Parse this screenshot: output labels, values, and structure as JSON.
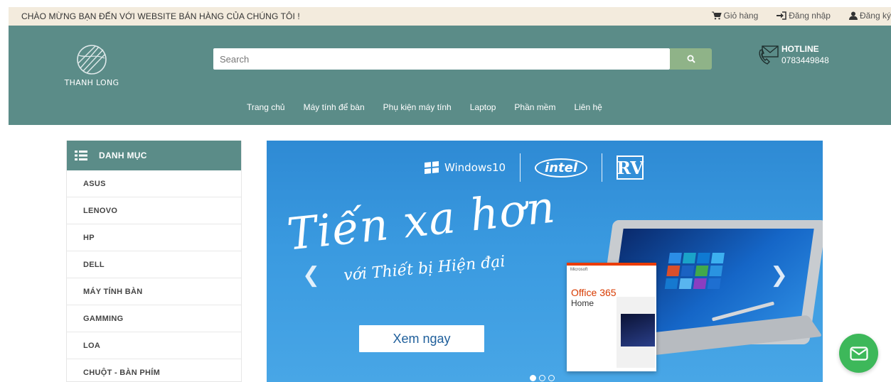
{
  "topbar": {
    "welcome": "CHÀO MỪNG BẠN ĐẾN VỚI WEBSITE BÁN HÀNG CỦA CHÚNG TÔI !",
    "cart": "Giỏ hàng",
    "login": "Đăng nhập",
    "register": "Đăng ký"
  },
  "header": {
    "logo_text": "THANH LONG",
    "search_placeholder": "Search",
    "hotline_title": "HOTLINE",
    "hotline_phone": "0783449848",
    "brand_color": "#5b8c88",
    "search_button_color": "#8fb388"
  },
  "nav": [
    "Trang chủ",
    "Máy tính để bàn",
    "Phụ kiện máy tính",
    "Laptop",
    "Phần mềm",
    "Liên hệ"
  ],
  "sidebar": {
    "title": "DANH MỤC",
    "items": [
      "ASUS",
      "LENOVO",
      "HP",
      "DELL",
      "MÁY TÍNH BÀN",
      "GAMMING",
      "LOA",
      "CHUỘT - BÀN PHÍM"
    ]
  },
  "banner": {
    "brand_windows": "Windows10",
    "brand_intel": "intel",
    "brand_rv": "RV",
    "slogan_main": "Tiến xa hơn",
    "slogan_sub": "với Thiết bị Hiện đại",
    "cta": "Xem ngay",
    "office_brand": "Microsoft",
    "office_title": "Office 365",
    "office_subtitle": "Home",
    "slides_total": 3,
    "active_slide": 1,
    "icons": [
      "chevron-left-icon",
      "chevron-right-icon"
    ]
  },
  "chat": {
    "icon": "email-icon",
    "color": "#3db85a"
  }
}
